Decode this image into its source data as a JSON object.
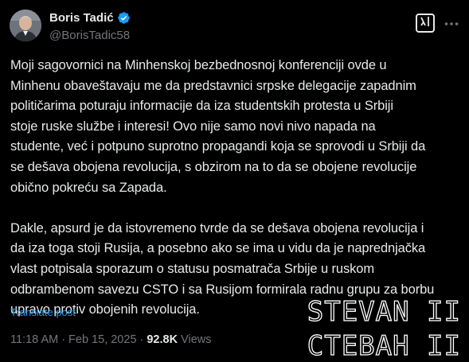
{
  "author": {
    "display_name": "Boris Tadić",
    "handle": "@BorisTadic58",
    "verified_icon": "verified-badge-icon",
    "verified_color": "#1d9bf0"
  },
  "header_actions": {
    "grok_icon": "grok-icon",
    "more_icon": "more-dots-icon"
  },
  "tweet": {
    "paragraph_1": "Moji sagovornici na Minhenskoj bezbednosnoj konferenciji ovde u\nMinhenu obaveštavaju me da predstavnici srpske delegacije zapadnim\npolitičarima poturaju informacije da iza studentskih protesta u Srbiji\nstoje ruske  službe i interesi! Ovo nije samo novi nivo napada na\nstudente, već i potpuno suprotno propagandi koja se sprovodi u Srbiji da\nse dešava obojena revolucija, s obzirom na to da se obojene revolucije\nobično pokreću sa Zapada.",
    "paragraph_2": "Dakle, apsurd je da istovremeno tvrde da se dešava obojena revolucija i\nda iza toga stoji Rusija, a posebno ako se ima u vidu da je naprednjačka\nvlast potpisala sporazum o statusu posmatrača Srbije u ruskom\nodbrambenom savezu CSTO i sa Rusijom formirala radnu grupu za borbu\nupravo protiv obojenih revolucija.",
    "translate_label": "Translate post"
  },
  "meta": {
    "time": "11:18 AM",
    "separator_1": "·",
    "date": "Feb 15, 2025",
    "separator_2": "·",
    "views_count": "92.8K",
    "views_label": "Views"
  },
  "watermark": {
    "latin": "STEVAN II",
    "cyrillic": "СТЕВАН II"
  },
  "colors": {
    "background": "#000000",
    "text": "#e7e9ea",
    "secondary_text": "#71767b",
    "link": "#1d9bf0"
  }
}
